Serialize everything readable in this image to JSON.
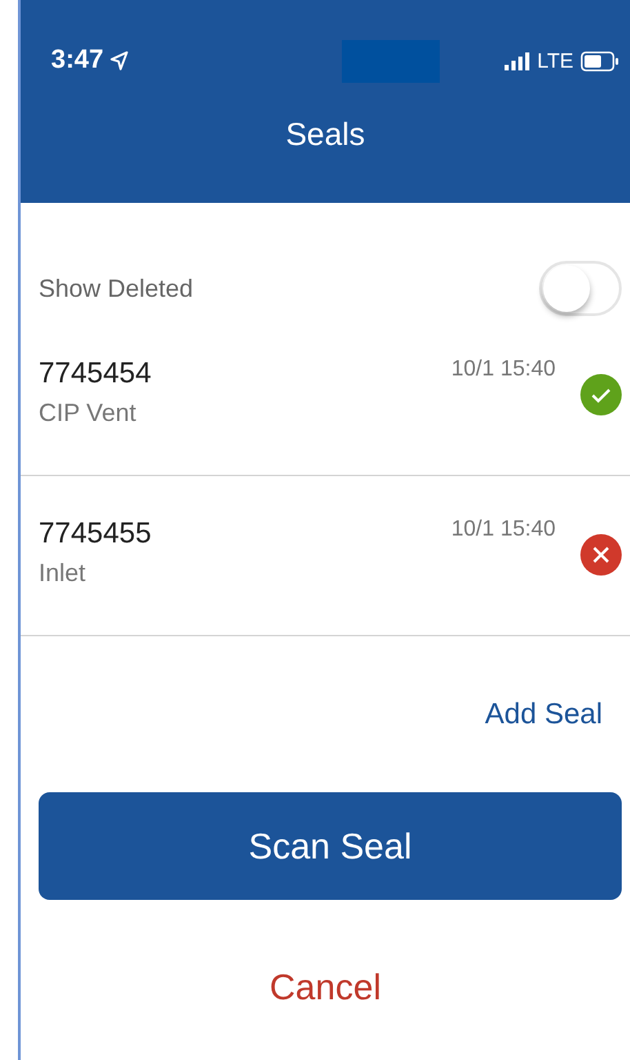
{
  "status_bar": {
    "time": "3:47",
    "network": "LTE"
  },
  "header": {
    "title": "Seals"
  },
  "show_deleted": {
    "label": "Show Deleted",
    "on": false
  },
  "seals": [
    {
      "number": "7745454",
      "location": "CIP Vent",
      "timestamp": "10/1 15:40",
      "kind": "valid"
    },
    {
      "number": "7745455",
      "location": "Inlet",
      "timestamp": "10/1 15:40",
      "kind": "invalid"
    }
  ],
  "add_link": "Add Seal",
  "primary_button": "Scan Seal",
  "cancel_button": "Cancel"
}
